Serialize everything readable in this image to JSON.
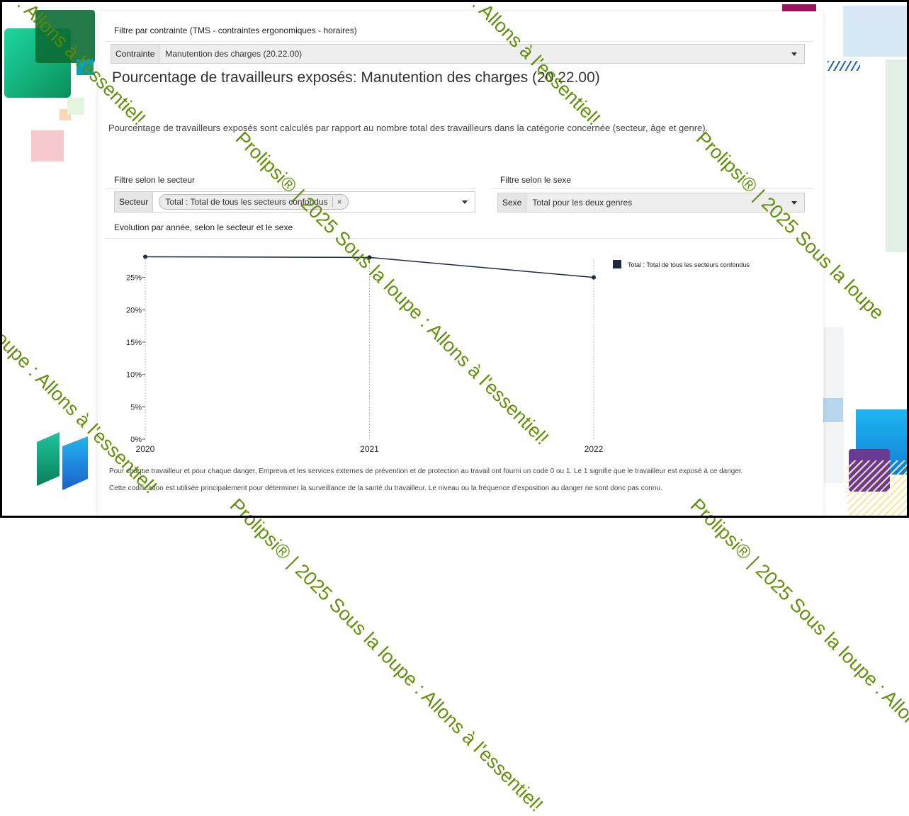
{
  "filters": {
    "constraint_section_label": "Filtre par contrainte (TMS - contraintes ergonomiques - horaires)",
    "constraint_addon": "Contrainte",
    "constraint_value": "Manutention des charges (20.22.00)",
    "sector_section_label": "Filtre selon le secteur",
    "sector_addon": "Secteur",
    "sector_chip": "Total : Total de tous les secteurs confondus",
    "sector_chip_remove": "×",
    "sex_section_label": "Filtre selon le sexe",
    "sex_addon": "Sexe",
    "sex_value": "Total pour les deux genres"
  },
  "page": {
    "title": "Pourcentage de travailleurs exposés: Manutention des charges (20.22.00)",
    "description": "Pourcentage de travailleurs exposés sont calculés par rapport au nombre total des travailleurs dans la catégorie concernée (secteur, âge et genre).",
    "chart_heading": "Evolution par année, selon le secteur et le sexe",
    "footnote_1": "Pour chaque travailleur et pour chaque danger, Empreva et les services externes de prévention et de protection au travail ont fourni un code 0 ou 1. Le 1 signifie que le travailleur est exposé à ce danger.",
    "footnote_2": "Cette codification est utilisée principalement pour déterminer la surveillance de la santé du travailleur. Le niveau ou la fréquence d'exposition au danger ne sont donc pas connu."
  },
  "watermark": {
    "text_a": ": Allons à l'essentiel!",
    "text_b": "Prolipsi® | 2025 Sous la loupe : Allons à l'essentiel!",
    "text_c": "loupe : Allons à l'essentiel!",
    "text_d": "Prolipsi® | 2025 Sous la loupe"
  },
  "colors": {
    "series": "#1b2b44",
    "watermark": "#5a8a00"
  },
  "chart_data": {
    "type": "line",
    "x": [
      "2020",
      "2021",
      "2022"
    ],
    "series": [
      {
        "name": "Total : Total de tous les secteurs confondus",
        "values": [
          28.2,
          28.1,
          25.0
        ]
      }
    ],
    "y_ticks": [
      "0%",
      "5%",
      "10%",
      "15%",
      "20%",
      "25%"
    ],
    "ylim": [
      0,
      30
    ],
    "grid": "vertical-dotted",
    "legend": "top-right"
  }
}
